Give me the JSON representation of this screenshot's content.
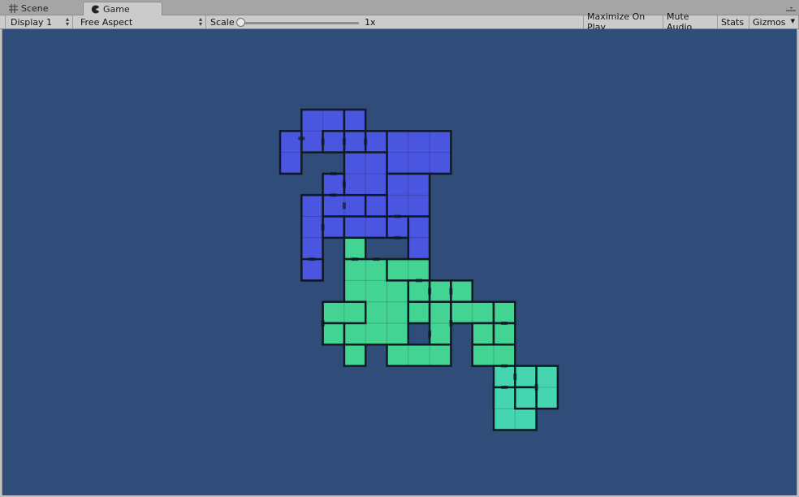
{
  "tabs": {
    "scene_label": "Scene",
    "game_label": "Game",
    "scene_icon": "hash-icon",
    "game_icon": "pacman-icon"
  },
  "toolbar": {
    "display_value": "Display 1",
    "aspect_value": "Free Aspect",
    "scale_label": "Scale",
    "scale_value": "1x",
    "scale_level": 0,
    "maximize_label": "Maximize On Play",
    "mute_label": "Mute Audio",
    "stats_label": "Stats",
    "gizmos_label": "Gizmos"
  },
  "game": {
    "background_color": "#2f4d78",
    "dungeon_a_color": "#4a55e0",
    "dungeon_b_color": "#43d493",
    "dungeon_c_color": "#45d6b0"
  }
}
